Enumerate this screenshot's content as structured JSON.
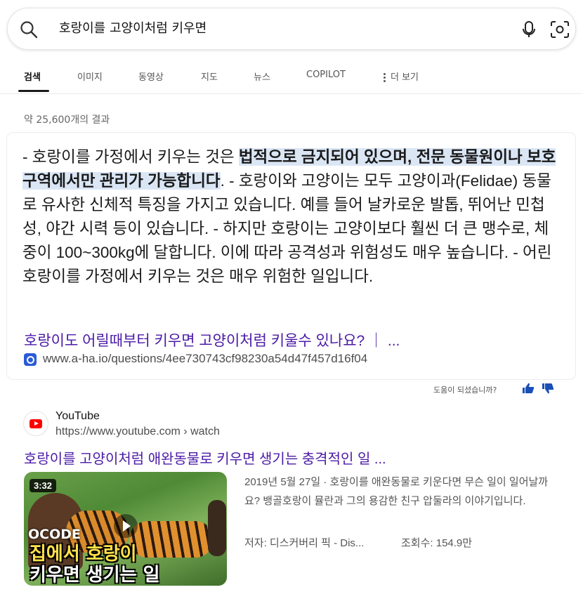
{
  "search": {
    "query": "호랑이를 고양이처럼 키우면",
    "icons": [
      "search-icon",
      "microphone-icon",
      "visual-search-icon"
    ]
  },
  "tabs": [
    {
      "label": "검색",
      "active": true
    },
    {
      "label": "이미지"
    },
    {
      "label": "동영상"
    },
    {
      "label": "지도"
    },
    {
      "label": "뉴스"
    },
    {
      "label": "COPILOT"
    },
    {
      "label": "더 보기"
    }
  ],
  "results_count": "약 25,600개의 결과",
  "answer": {
    "text_before": "- 호랑이를 가정에서 키우는 것은 ",
    "highlight": "법적으로 금지되어 있으며, 전문 동물원이나 보호구역에서만 관리가 가능합니다",
    "text_after": ". - 호랑이와 고양이는 모두 고양이과(Felidae) 동물로 유사한 신체적 특징을 가지고 있습니다. 예를 들어 날카로운 발톱, 뛰어난 민첩성, 야간 시력 등이 있습니다. - 하지만 호랑이는 고양이보다 훨씬 더 큰 맹수로, 체중이 100~300kg에 달합니다. 이에 따라 공격성과 위험성도 매우 높습니다. - 어린 호랑이를 가정에서 키우는 것은 매우 위험한 일입니다.",
    "source_title": "호랑이도 어릴때부터 키우면 고양이처럼 키울수 있나요? ｜ ...",
    "source_url": "www.a-ha.io/questions/4ee730743cf98230a54d47f457d16f04"
  },
  "feedback": {
    "label": "도움이 되셨습니까?",
    "accent": "#1a4fb8"
  },
  "video_result": {
    "site_name": "YouTube",
    "site_url": "https://www.youtube.com › watch",
    "title": "호랑이를 고양이처럼 애완동물로 키우면 생기는 충격적인 일 ...",
    "duration": "3:32",
    "thumb_brand": "OCODE",
    "thumb_caption_1": "집에서 호랑이",
    "thumb_caption_2": "키우면 생기는 일",
    "snippet": "2019년 5월 27일 · 호랑이를 애완동물로 키운다면 무슨 일이 일어날까요? 뱅골호랑이 뮬란과 그의 용감한 친구 압둘라의 이야기입니다.",
    "author": "저자: 디스커버리 픽 - Dis...",
    "views": "조회수: 154.9만"
  },
  "colors": {
    "link": "#4a1aa6",
    "highlight_bg": "#dbe6f5",
    "youtube_red": "#ff0000"
  }
}
